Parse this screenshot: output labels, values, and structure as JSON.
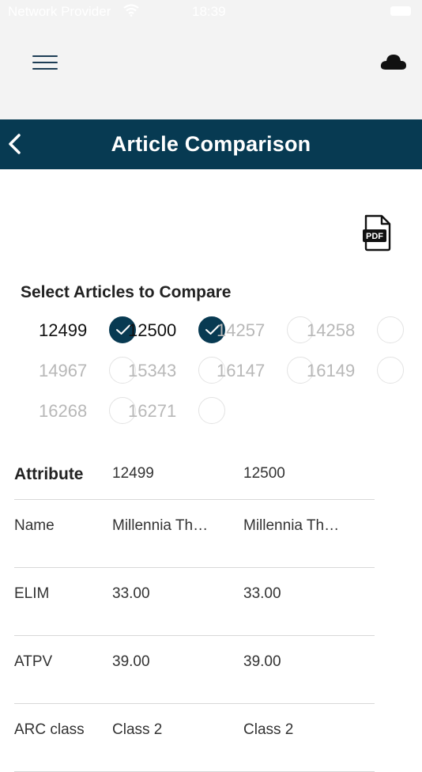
{
  "status_bar": {
    "carrier": "Network Provider",
    "time": "18:39"
  },
  "header": {
    "menu_icon": "hamburger-menu-icon",
    "cloud_icon": "cloud-icon"
  },
  "nav": {
    "back_icon": "chevron-left-icon",
    "title": "Article Comparison"
  },
  "toolbar": {
    "pdf_icon": "pdf-file-icon",
    "pdf_label": "PDF"
  },
  "select_section": {
    "title": "Select Articles to Compare",
    "articles": [
      {
        "number": "12499",
        "checked": true
      },
      {
        "number": "12500",
        "checked": true
      },
      {
        "number": "14257",
        "checked": false
      },
      {
        "number": "14258",
        "checked": false
      },
      {
        "number": "14967",
        "checked": false
      },
      {
        "number": "15343",
        "checked": false
      },
      {
        "number": "16147",
        "checked": false
      },
      {
        "number": "16149",
        "checked": false
      },
      {
        "number": "16268",
        "checked": false
      },
      {
        "number": "16271",
        "checked": false
      }
    ]
  },
  "table": {
    "headers": [
      "Attribute",
      "12499",
      "12500"
    ],
    "rows": [
      [
        "Name",
        "Millennia Th…",
        "Millennia Th…"
      ],
      [
        "ELIM",
        "33.00",
        "33.00"
      ],
      [
        "ATPV",
        "39.00",
        "39.00"
      ],
      [
        "ARC class",
        "Class 2",
        "Class 2"
      ]
    ]
  },
  "colors": {
    "nav_background": "#073a52",
    "checked_circle": "#083a52",
    "top_background": "#f3f3f3"
  }
}
